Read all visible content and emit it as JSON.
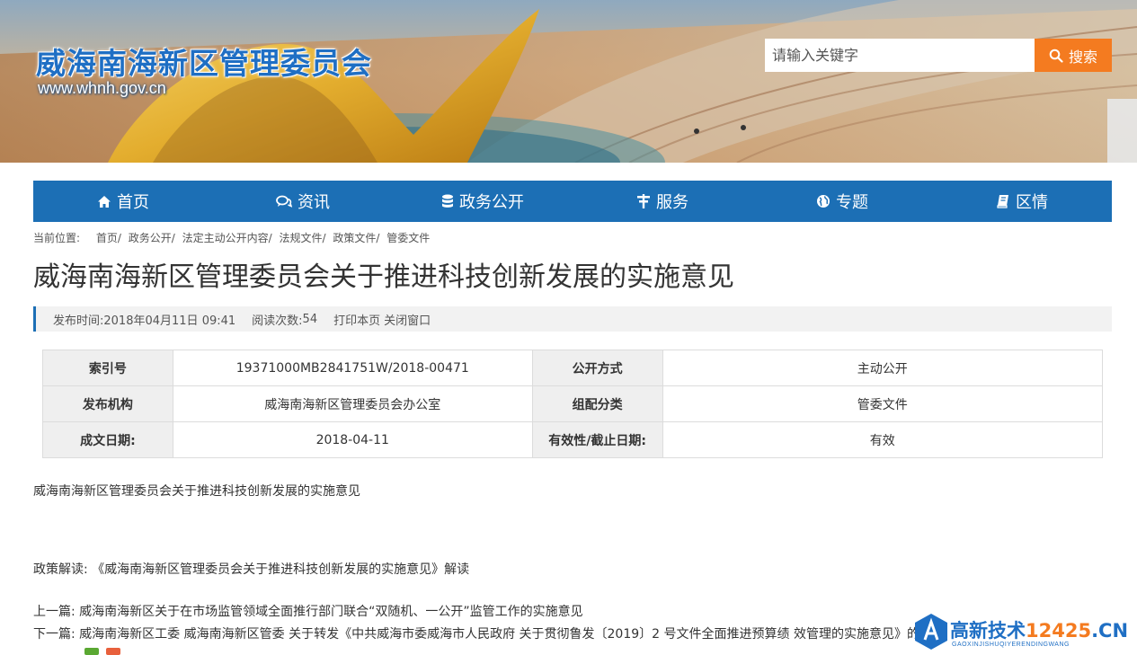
{
  "site": {
    "title": "威海南海新区管理委员会",
    "url": "www.whnh.gov.cn"
  },
  "search": {
    "placeholder": "请输入关键字",
    "button_label": "搜索"
  },
  "nav": {
    "items": [
      {
        "label": "首页",
        "icon": "home-icon"
      },
      {
        "label": "资讯",
        "icon": "comments-icon"
      },
      {
        "label": "政务公开",
        "icon": "database-icon"
      },
      {
        "label": "服务",
        "icon": "service-icon"
      },
      {
        "label": "专题",
        "icon": "globe-icon"
      },
      {
        "label": "区情",
        "icon": "book-icon"
      }
    ]
  },
  "breadcrumb": {
    "prefix": "当前位置:",
    "items": [
      "首页/",
      "政务公开/",
      "法定主动公开内容/",
      "法规文件/",
      "政策文件/",
      "管委文件"
    ]
  },
  "article": {
    "title": "威海南海新区管理委员会关于推进科技创新发展的实施意见",
    "meta": {
      "publish_label": "发布时间:",
      "publish_time": "2018年04月11日 09:41",
      "views_label": "阅读次数:",
      "views": "54",
      "print": "打印本页",
      "close": "关闭窗口"
    },
    "info": [
      [
        {
          "key": "索引号",
          "value": "19371000MB2841751W/2018-00471"
        },
        {
          "key": "公开方式",
          "value": "主动公开"
        }
      ],
      [
        {
          "key": "发布机构",
          "value": "威海南海新区管理委员会办公室"
        },
        {
          "key": "组配分类",
          "value": "管委文件"
        }
      ],
      [
        {
          "key": "成文日期:",
          "value": "2018-04-11"
        },
        {
          "key": "有效性/截止日期:",
          "value": "有效"
        }
      ]
    ],
    "body_title": "威海南海新区管理委员会关于推进科技创新发展的实施意见",
    "interpretation_label": "政策解读:",
    "interpretation_link": "《威海南海新区管理委员会关于推进科技创新发展的实施意见》解读",
    "prev_label": "上一篇:",
    "prev_link": "威海南海新区关于在市场监管领域全面推行部门联合“双随机、一公开”监管工作的实施意见",
    "next_label": "下一篇:",
    "next_link": "威海南海新区工委 威海南海新区管委 关于转发《中共威海市委威海市人民政府 关于贯彻鲁发〔2019〕2 号文件全面推进预算绩 效管理的实施意见》的"
  },
  "watermark": {
    "title": "高新技术",
    "number": "12425",
    "suffix": ".CN",
    "subtitle": "GAOXINJISHUQIYERENDINGWANG"
  },
  "colors": {
    "primary": "#1c6fb5",
    "accent": "#f47b20",
    "table_key_bg": "#efefef"
  }
}
